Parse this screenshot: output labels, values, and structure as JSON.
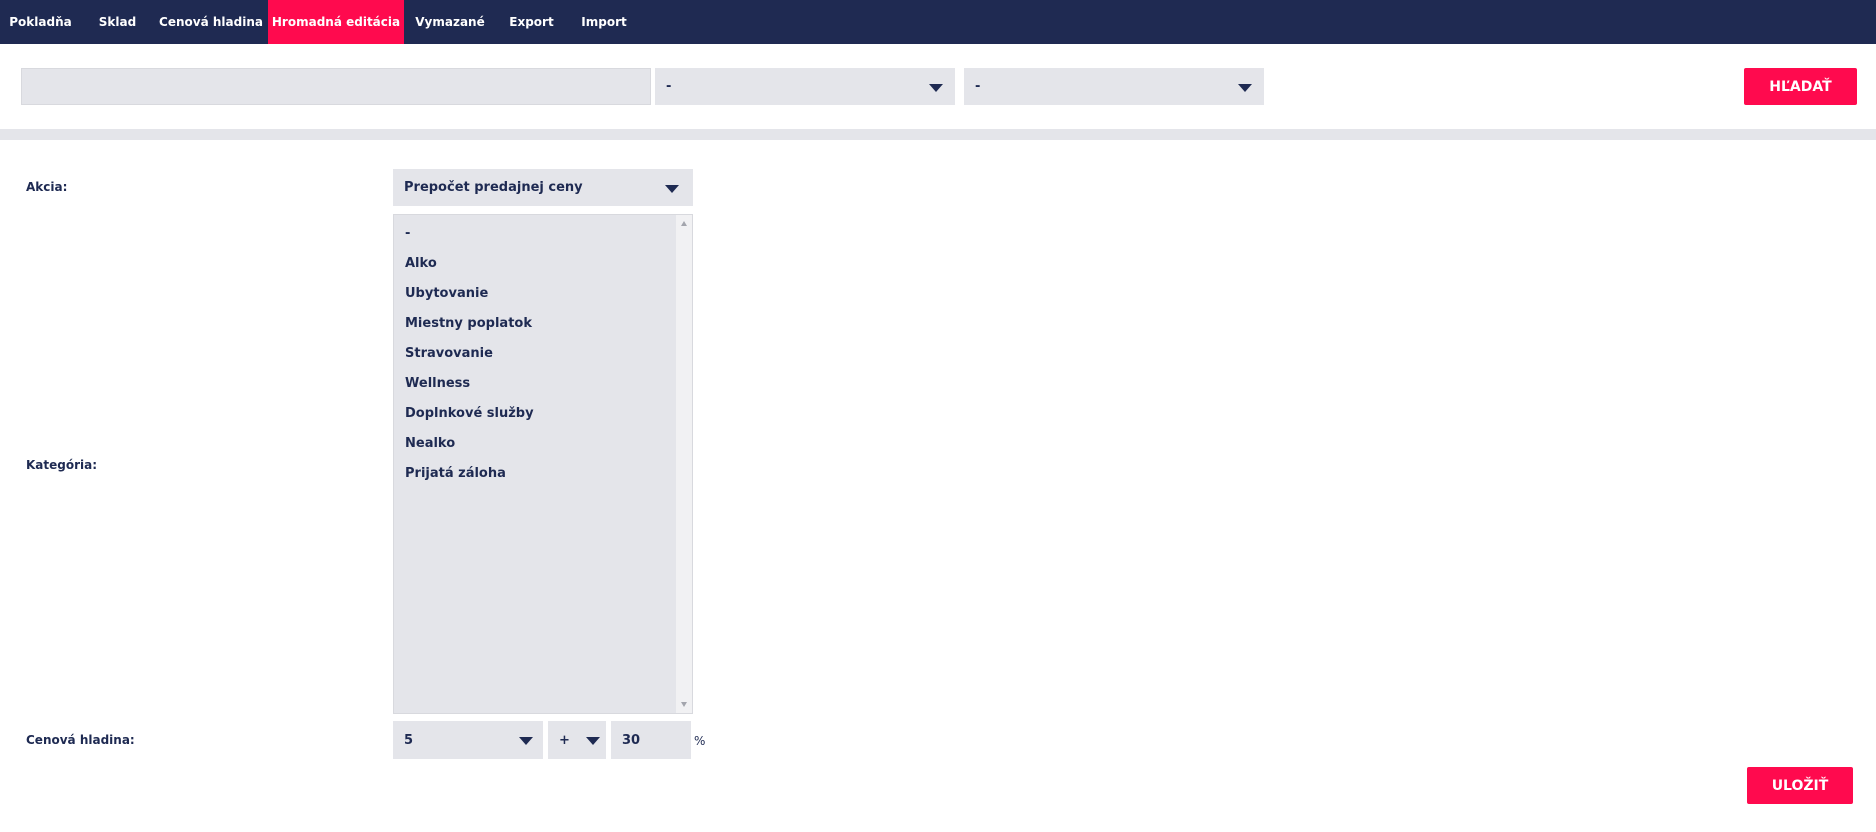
{
  "nav": {
    "items": [
      {
        "label": "Pokladňa"
      },
      {
        "label": "Sklad"
      },
      {
        "label": "Cenová hladina"
      },
      {
        "label": "Hromadná editácia"
      },
      {
        "label": "Vymazané"
      },
      {
        "label": "Export"
      },
      {
        "label": "Import"
      }
    ],
    "active": "Hromadná editácia"
  },
  "search": {
    "query": "",
    "filter1_value": "-",
    "filter2_value": "-",
    "button_label": "HĽADAŤ"
  },
  "form": {
    "action_label": "Akcia:",
    "action_value": "Prepočet predajnej ceny",
    "category_label": "Kategória:",
    "categories": [
      "-",
      "Alko",
      "Ubytovanie",
      "Miestny poplatok",
      "Stravovanie",
      "Wellness",
      "Doplnkové služby",
      "Nealko",
      "Prijatá záloha"
    ],
    "price_level_label": "Cenová hladina:",
    "price_level_value": "5",
    "operator_value": "+",
    "amount_value": "30",
    "unit": "%",
    "save_label": "ULOŽIŤ"
  },
  "colors": {
    "nav_bg": "#1f2a52",
    "accent": "#ff0a4e",
    "field_bg": "#e4e5ea",
    "text": "#1e2a52"
  }
}
